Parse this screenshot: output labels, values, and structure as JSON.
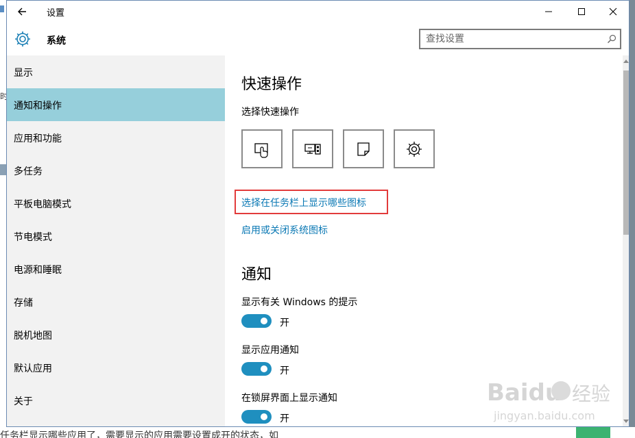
{
  "window": {
    "title": "设置",
    "header_title": "系统"
  },
  "search": {
    "placeholder": "查找设置"
  },
  "sidebar": {
    "items": [
      {
        "label": "显示"
      },
      {
        "label": "通知和操作"
      },
      {
        "label": "应用和功能"
      },
      {
        "label": "多任务"
      },
      {
        "label": "平板电脑模式"
      },
      {
        "label": "节电模式"
      },
      {
        "label": "电源和睡眠"
      },
      {
        "label": "存储"
      },
      {
        "label": "脱机地图"
      },
      {
        "label": "默认应用"
      },
      {
        "label": "关于"
      }
    ],
    "active_index": 1
  },
  "quick_actions": {
    "heading": "快速操作",
    "subheading": "选择快速操作",
    "tiles": [
      {
        "icon": "tablet-mode-icon"
      },
      {
        "icon": "project-icon"
      },
      {
        "icon": "note-icon"
      },
      {
        "icon": "settings-gear-icon"
      }
    ],
    "link_taskbar": "选择在任务栏上显示哪些图标",
    "link_system_icons": "启用或关闭系统图标"
  },
  "notifications": {
    "heading": "通知",
    "settings": [
      {
        "label": "显示有关 Windows 的提示",
        "state": "开"
      },
      {
        "label": "显示应用通知",
        "state": "开"
      },
      {
        "label": "在锁屏界面上显示通知",
        "state": "开"
      }
    ]
  },
  "background": {
    "bottom_text": "任务栏显示哪些应用了，需要显示的应用需要设置成开的状态，如",
    "side_char": "时"
  },
  "watermark": {
    "brand": "Baidu",
    "brand_cn": "经验",
    "url": "jingyan.baidu.com"
  },
  "colors": {
    "accent": "#1f8fbf",
    "sidebar_active": "#96cfdb",
    "link": "#0a78b4",
    "highlight_box": "#e23a3a"
  }
}
